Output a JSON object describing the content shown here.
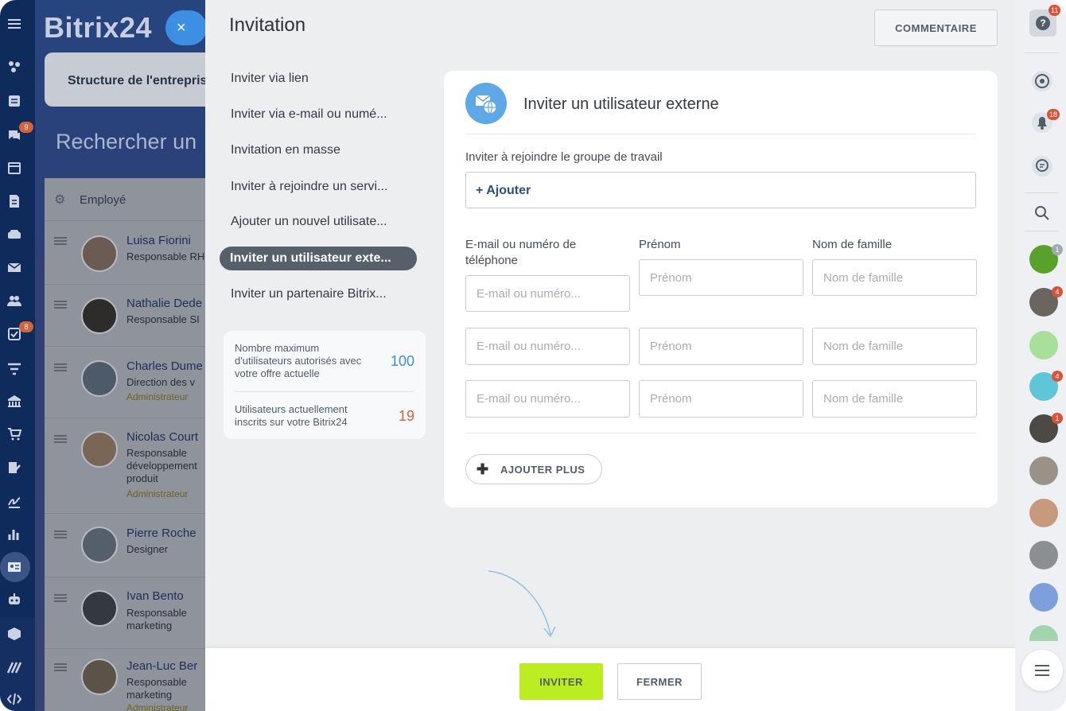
{
  "app": {
    "brand": "Bitrix24",
    "close_icon": "×"
  },
  "left_nav": {
    "icons": [
      "menu-icon",
      "feed-icon",
      "tasks-list-icon",
      "chat-icon",
      "calendar-icon",
      "documents-icon",
      "drive-icon",
      "mail-icon",
      "team-icon",
      "tasks-icon",
      "filter-icon",
      "company-icon",
      "shop-icon",
      "sign-icon",
      "signature-icon",
      "analytics-icon",
      "employees-icon",
      "robot-icon",
      "box-icon",
      "marketplace-icon",
      "code-icon"
    ],
    "badges": {
      "chat": "9",
      "tasks": "8"
    }
  },
  "background_page": {
    "structure_button": "Structure de l'entreprise",
    "search_heading": "Rechercher un",
    "column_header": "Employé",
    "employees": [
      {
        "name": "Luisa Fiorini",
        "position": "Responsable RH",
        "role": ""
      },
      {
        "name": "Nathalie Dede",
        "position": "Responsable SI",
        "role": ""
      },
      {
        "name": "Charles Dume",
        "position": "Direction des v",
        "role": "Administrateur"
      },
      {
        "name": "Nicolas Court",
        "position": "Responsable développement produit",
        "role": "Administrateur"
      },
      {
        "name": "Pierre Roche",
        "position": "Designer",
        "role": ""
      },
      {
        "name": "Ivan Bento",
        "position": "Responsable marketing",
        "role": ""
      },
      {
        "name": "Jean-Luc Ber",
        "position": "Responsable marketing",
        "role": "Administrateur"
      }
    ]
  },
  "slider": {
    "title": "Invitation",
    "comment_button": "COMMENTAIRE",
    "menu": [
      "Inviter via lien",
      "Inviter via e-mail ou numé...",
      "Invitation en masse",
      "Inviter à rejoindre un servi...",
      "Ajouter un nouvel utilisate...",
      "Inviter un utilisateur exte...",
      "Inviter un partenaire Bitrix..."
    ],
    "selected_menu_index": 5,
    "stats": {
      "max_label": "Nombre maximum d'utilisateurs autorisés avec votre offre actuelle",
      "max_value": "100",
      "current_label": "Utilisateurs actuellement inscrits sur votre Bitrix24",
      "current_value": "19",
      "colors": {
        "max": "#3a8fd9",
        "current": "#e0593c"
      }
    },
    "form": {
      "icon": "external-mail-globe-icon",
      "heading": "Inviter un utilisateur externe",
      "group_label": "Inviter à rejoindre le groupe de travail",
      "add_link": "+ Ajouter",
      "col_email": "E-mail ou numéro de téléphone",
      "col_firstname": "Prénom",
      "col_lastname": "Nom de famille",
      "rows": [
        {
          "email_placeholder": "E-mail ou numéro...",
          "firstname_placeholder": "Prénom",
          "lastname_placeholder": "Nom de famille"
        },
        {
          "email_placeholder": "E-mail ou numéro...",
          "firstname_placeholder": "Prénom",
          "lastname_placeholder": "Nom de famille"
        },
        {
          "email_placeholder": "E-mail ou numéro...",
          "firstname_placeholder": "Prénom",
          "lastname_placeholder": "Nom de famille"
        }
      ],
      "add_more": "AJOUTER PLUS"
    },
    "footer": {
      "invite_button": "INVITER",
      "close_button": "FERMER",
      "invite_color": "#bbed21"
    }
  },
  "right_bar": {
    "help_badge": "11",
    "notifications_badge": "18",
    "avatar_badges": [
      "1",
      "4",
      "",
      "4",
      "1"
    ]
  }
}
